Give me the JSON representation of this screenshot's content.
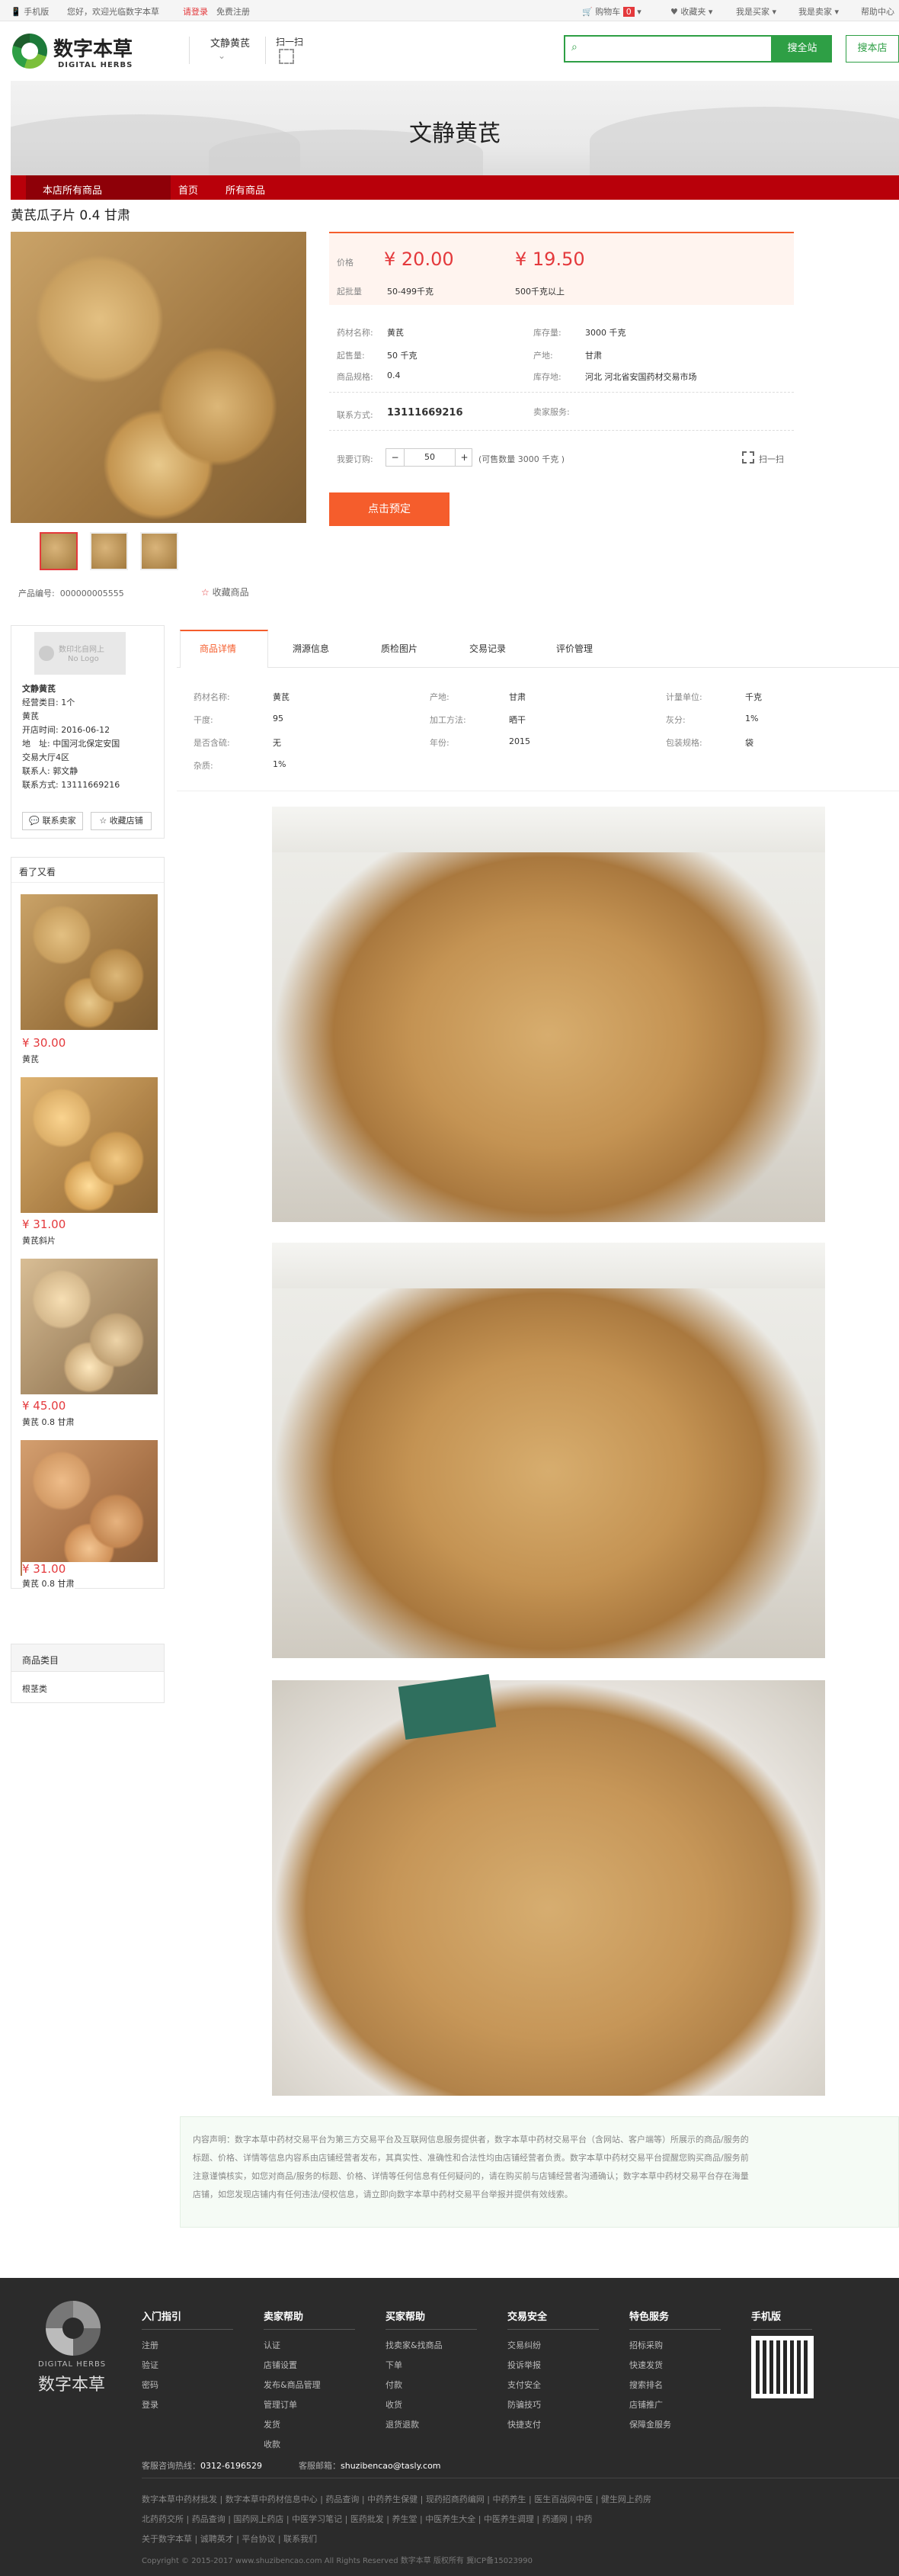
{
  "topbar": {
    "mobile": "手机版",
    "hello": "您好，欢迎光临数字本草",
    "login": "请登录",
    "register": "免费注册",
    "cart": "购物车",
    "cart_count": "0",
    "favorites": "收藏夹",
    "buyer": "我是买家",
    "seller": "我是卖家",
    "help": "帮助中心"
  },
  "header": {
    "logo_cn": "数字本草",
    "logo_en": "DIGITAL HERBS",
    "shop_name": "文静黄芪",
    "scan": "扫一扫",
    "search_placeholder": "",
    "search_site": "搜全站",
    "search_shop": "搜本店"
  },
  "banner": {
    "title": "文静黄芪"
  },
  "nav": {
    "all_goods": "本店所有商品",
    "home": "首页",
    "all": "所有商品"
  },
  "product": {
    "title": "黄芪瓜子片 0.4 甘肃",
    "price_label": "价格",
    "price1": "¥ 20.00",
    "price2": "¥ 19.50",
    "batch_label": "起批量",
    "batch1": "50-499千克",
    "batch2": "500千克以上",
    "name_label": "药材名称:",
    "name": "黄芪",
    "stock_label": "库存量:",
    "stock": "3000 千克",
    "start_label": "起售量:",
    "start": "50 千克",
    "origin_label": "产地:",
    "origin": "甘肃",
    "spec_label": "商品规格:",
    "spec": "0.4",
    "storage_label": "库存地:",
    "storage": "河北 河北省安国药材交易市场",
    "contact_label": "联系方式:",
    "contact": "13111669216",
    "service_label": "卖家服务:",
    "order_label": "我要订购:",
    "qty": "50",
    "available": "(可售数量 3000 千克 )",
    "scan": "扫一扫",
    "preorder": "点击预定",
    "code_label": "产品编号:",
    "code": "000000005555",
    "fav": "收藏商品"
  },
  "shop": {
    "nologo": "数印北自网上",
    "nologo2": "No Logo",
    "name": "文静黄芪",
    "category_label": "经营类目:",
    "category_count": "1个",
    "category": "黄芪",
    "open_label": "开店时间:",
    "open": "2016-06-12",
    "addr_label": "地　址:",
    "addr": "中国河北保定安国",
    "addr2": "交易大厅4区",
    "person_label": "联系人:",
    "person": "郭文静",
    "phone_label": "联系方式:",
    "phone": "13111669216",
    "contact_btn": "联系卖家",
    "fav_btn": "收藏店铺"
  },
  "seen": {
    "title": "看了又看",
    "items": [
      {
        "price": "¥ 30.00",
        "name": "黄芪"
      },
      {
        "price": "¥ 31.00",
        "name": "黄芪斜片"
      },
      {
        "price": "¥ 45.00",
        "name": "黄芪 0.8 甘肃"
      },
      {
        "price": "¥ 31.00",
        "name": "黄芪 0.8 甘肃"
      }
    ]
  },
  "category_box": {
    "title": "商品类目",
    "item": "根茎类"
  },
  "tabs": [
    "商品详情",
    "溯源信息",
    "质检图片",
    "交易记录",
    "评价管理"
  ],
  "details": {
    "r1": [
      "药材名称:",
      "黄芪",
      "产地:",
      "甘肃",
      "计量单位:",
      "千克"
    ],
    "r2": [
      "干度:",
      "95",
      "加工方法:",
      "晒干",
      "灰分:",
      "1%"
    ],
    "r3": [
      "是否含硫:",
      "无",
      "年份:",
      "2015",
      "包装规格:",
      "袋"
    ],
    "r4": [
      "杂质:",
      "1%"
    ]
  },
  "disclaimer": {
    "l1": "内容声明：数字本草中药材交易平台为第三方交易平台及互联网信息服务提供者，数字本草中药材交易平台（含网站、客户端等）所展示的商品/服务的",
    "l2": "标题、价格、详情等信息内容系由店铺经营者发布，其真实性、准确性和合法性均由店铺经营者负责。数字本草中药材交易平台提醒您购买商品/服务前",
    "l3": "注意谨慎核实，如您对商品/服务的标题、价格、详情等任何信息有任何疑问的，请在购买前与店铺经营者沟通确认；数字本草中药材交易平台存在海量",
    "l4": "店铺，如您发现店铺内有任何违法/侵权信息，请立即向数字本草中药材交易平台举报并提供有效线索。"
  },
  "footer": {
    "logo_en": "DIGITAL HERBS",
    "logo_cn": "数字本草",
    "cols": [
      {
        "title": "入门指引",
        "items": [
          "注册",
          "验证",
          "密码",
          "登录"
        ]
      },
      {
        "title": "卖家帮助",
        "items": [
          "认证",
          "店铺设置",
          "发布&商品管理",
          "管理订单",
          "发货",
          "收款"
        ]
      },
      {
        "title": "买家帮助",
        "items": [
          "找卖家&找商品",
          "下单",
          "付款",
          "收货",
          "退货退款"
        ]
      },
      {
        "title": "交易安全",
        "items": [
          "交易纠纷",
          "投诉举报",
          "支付安全",
          "防骗技巧",
          "快捷支付"
        ]
      },
      {
        "title": "特色服务",
        "items": [
          "招标采购",
          "快速发货",
          "搜索排名",
          "店铺推广",
          "保障金服务"
        ]
      },
      {
        "title": "手机版",
        "items": []
      }
    ],
    "hotline": "客服咨询热线：",
    "hotline_no": "0312-6196529",
    "email_label": "客服邮箱：",
    "email": "shuzibencao@tasly.com",
    "links1": [
      "数字本草中药材批发",
      "数字本草中药材信息中心",
      "药品查询",
      "中药养生保健",
      "现药招商药编网",
      "中药养生",
      "医生百战网中医",
      "健生网上药房"
    ],
    "links2": [
      "北药药交所",
      "药品查询",
      "国药网上药店",
      "中医学习笔记",
      "医药批发",
      "养生堂",
      "中医养生大全",
      "中医养生调理",
      "药通网",
      "中药"
    ],
    "links3": [
      "关于数字本草",
      "诚聘英才",
      "平台协议",
      "联系我们"
    ],
    "copyright": "Copyright © 2015-2017 www.shuzibencao.com All Rights Reserved 数字本草 版权所有 冀ICP备15023990"
  }
}
